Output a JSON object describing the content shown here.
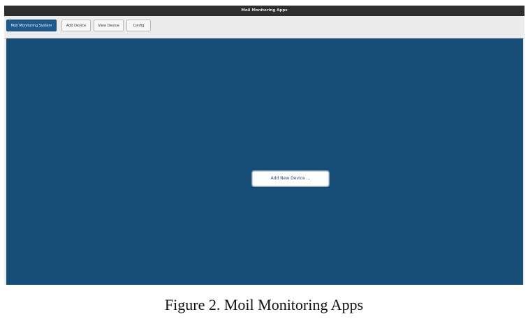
{
  "window": {
    "title": "Moil Monitoring Apps"
  },
  "toolbar": {
    "tabs": [
      {
        "label": "Moil Monitoring System",
        "active": true
      },
      {
        "label": "Add Device",
        "active": false
      },
      {
        "label": "View Device",
        "active": false
      },
      {
        "label": "Config",
        "active": false
      }
    ]
  },
  "main": {
    "add_device_button_label": "Add New Device ..."
  },
  "caption": "Figure 2. Moil Monitoring Apps",
  "colors": {
    "panel_background": "#164e78",
    "active_tab": "#1f5a8e",
    "titlebar": "#2e2e2e"
  }
}
